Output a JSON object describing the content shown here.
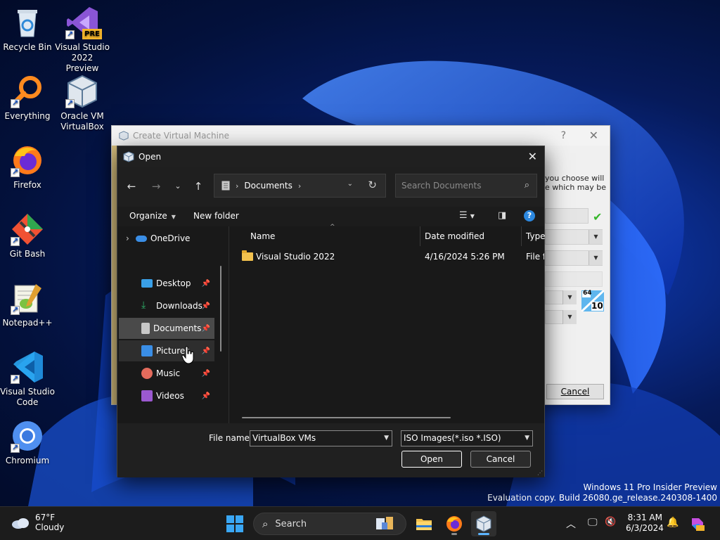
{
  "desktop": {
    "icons": [
      {
        "label": "Recycle Bin"
      },
      {
        "label": "Visual Studio 2022 Preview",
        "badge": "PRE"
      },
      {
        "label": "Everything"
      },
      {
        "label": "Oracle VM VirtualBox"
      },
      {
        "label": "Firefox"
      },
      {
        "label": "Git Bash"
      },
      {
        "label": "Notepad++"
      },
      {
        "label": "Visual Studio Code"
      },
      {
        "label": "Chromium"
      }
    ],
    "watermark": {
      "line1": "Windows 11 Pro Insider Preview",
      "line2": "Evaluation copy. Build 26080.ge_release.240308-1400"
    }
  },
  "create_vm_dialog": {
    "title": "Create Virtual Machine",
    "help": "?",
    "close": "✕",
    "text_line1": "you choose will",
    "text_line2": "e which may be",
    "os_badge": "10",
    "os_bits": "64",
    "cancel_label": "Cancel"
  },
  "open_dialog": {
    "title": "Open",
    "address": {
      "segment": "Documents"
    },
    "search_placeholder": "Search Documents",
    "commands": {
      "organize": "Organize",
      "new_folder": "New folder"
    },
    "nav_items": [
      {
        "label": "OneDrive",
        "icon": "cloud-icon",
        "color": "#3a8ee6",
        "pinned": false
      },
      {
        "label": "Desktop",
        "icon": "desktop-icon",
        "color": "#3aa0e8",
        "pinned": true
      },
      {
        "label": "Downloads",
        "icon": "download-icon",
        "color": "#2fb36b",
        "pinned": true
      },
      {
        "label": "Documents",
        "icon": "document-icon",
        "color": "#c8c8c8",
        "pinned": true
      },
      {
        "label": "Pictures",
        "icon": "pictures-icon",
        "color": "#3a8ee6",
        "pinned": true
      },
      {
        "label": "Music",
        "icon": "music-icon",
        "color": "#e36b5c",
        "pinned": true
      },
      {
        "label": "Videos",
        "icon": "videos-icon",
        "color": "#9b59d0",
        "pinned": true
      }
    ],
    "columns": {
      "name": "Name",
      "date": "Date modified",
      "type": "Type"
    },
    "files": [
      {
        "name": "Visual Studio 2022",
        "date": "4/16/2024 5:26 PM",
        "type": "File fo"
      }
    ],
    "file_name_label": "File name:",
    "file_name_value": "VirtualBox VMs",
    "file_type_value": "ISO Images(*.iso *.ISO)",
    "open_label": "Open",
    "cancel_label": "Cancel"
  },
  "taskbar": {
    "weather": {
      "temp": "67°F",
      "condition": "Cloudy"
    },
    "search_label": "Search",
    "clock": {
      "time": "8:31 AM",
      "date": "6/3/2024"
    }
  },
  "colors": {
    "accent": "#2c88e0",
    "folder": "#f2c14e",
    "start": "#3aa7f5"
  }
}
